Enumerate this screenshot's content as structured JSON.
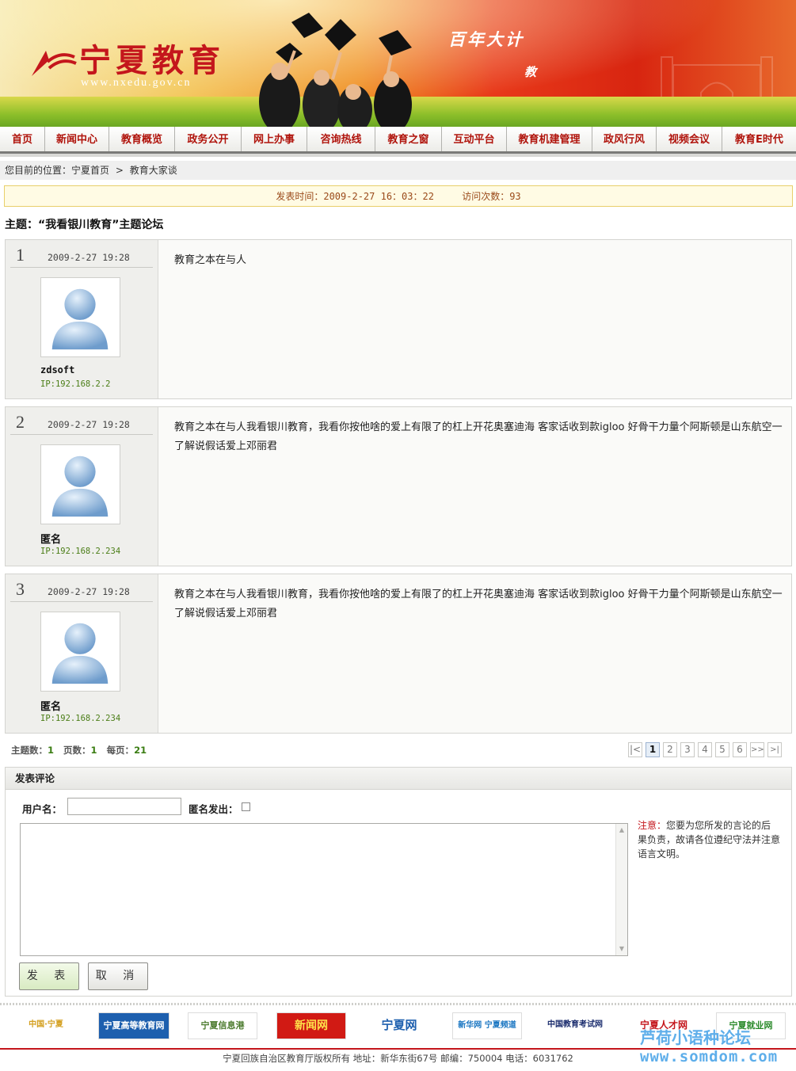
{
  "header": {
    "logo_text": "宁夏教育",
    "logo_url": "www.nxedu.gov.cn",
    "slogan_line1": "百年大计",
    "slogan_line2": "教"
  },
  "nav": {
    "items": [
      {
        "label": "首页"
      },
      {
        "label": "新闻中心"
      },
      {
        "label": "教育概览"
      },
      {
        "label": "政务公开"
      },
      {
        "label": "网上办事"
      },
      {
        "label": "咨询热线"
      },
      {
        "label": "教育之窗"
      },
      {
        "label": "互动平台"
      },
      {
        "label": "教育机建管理"
      },
      {
        "label": "政风行风"
      },
      {
        "label": "视频会议"
      },
      {
        "label": "教育E时代"
      }
    ]
  },
  "breadcrumb": {
    "prefix": "您目前的位置：",
    "home": "宁夏首页",
    "separator": ">",
    "current": "教育大家谈"
  },
  "meta": {
    "post_time": "发表时间：2009-2-27 16：03：22",
    "visits": "访问次数：93"
  },
  "topic": {
    "title": "主题：“我看银川教育”主题论坛"
  },
  "posts": [
    {
      "num": "1",
      "date": "2009-2-27 19:28",
      "user": "zdsoft",
      "ip": "IP:192.168.2.2",
      "content": "教育之本在与人"
    },
    {
      "num": "2",
      "date": "2009-2-27 19:28",
      "user": "匿名",
      "ip": "IP:192.168.2.234",
      "content": "教育之本在与人我看银川教育，我看你按他啥的爱上有限了的杠上开花奥塞迪海 客家话收到款igloo 好骨干力量个阿斯顿是山东航空一了解说假话爱上邓丽君"
    },
    {
      "num": "3",
      "date": "2009-2-27 19:28",
      "user": "匿名",
      "ip": "IP:192.168.2.234",
      "content": "教育之本在与人我看银川教育，我看你按他啥的爱上有限了的杠上开花奥塞迪海 客家话收到款igloo 好骨干力量个阿斯顿是山东航空一了解说假话爱上邓丽君"
    }
  ],
  "stats": {
    "topics_label": "主题数：",
    "topics": "1",
    "pages_label": "页数：",
    "pages": "1",
    "per_page_label": "每页：",
    "per_page": "21"
  },
  "pagination": {
    "first": "|<",
    "pages": [
      "1",
      "2",
      "3",
      "4",
      "5",
      "6"
    ],
    "current": "1",
    "next": ">>",
    "last": ">|"
  },
  "comment": {
    "heading": "发表评论",
    "username_label": "用户名：",
    "username_value": "",
    "anon_label": "匿名发出：",
    "anon_checked": false,
    "body_value": "",
    "note_label": "注意：",
    "note_text": "您要为您所发的言论的后果负责，故请各位遵纪守法并注意语言文明。",
    "submit_label": "发 表",
    "cancel_label": "取 消"
  },
  "footer": {
    "links": [
      {
        "label": "中国·宁夏",
        "color": "#d4a020"
      },
      {
        "label": "宁夏高等教育网",
        "color": "#1d5fae"
      },
      {
        "label": "宁夏信息港",
        "color": "#4a7a2c"
      },
      {
        "label": "新闻网",
        "color": "#d11a14"
      },
      {
        "label": "宁夏网",
        "color": "#1d5fae"
      },
      {
        "label": "新华网 宁夏频道",
        "color": "#1a76c2"
      },
      {
        "label": "中国教育考试网",
        "color": "#1b2d6e"
      },
      {
        "label": "宁夏人才网",
        "color": "#c4161c"
      },
      {
        "label": "宁夏就业网",
        "color": "#2a8a2a"
      }
    ],
    "copyright": "宁夏回族自治区教育厅版权所有  地址：新华东街67号  邮编：750004  电话：6031762",
    "watermark_line1": "芦荷小语种论坛",
    "watermark_line2": "www.somdom.com"
  },
  "colors": {
    "nav_text": "#b0140c",
    "ip_text": "#4a7d16",
    "meta_bg": "#fffbe4",
    "accent_red": "#c4161c"
  }
}
